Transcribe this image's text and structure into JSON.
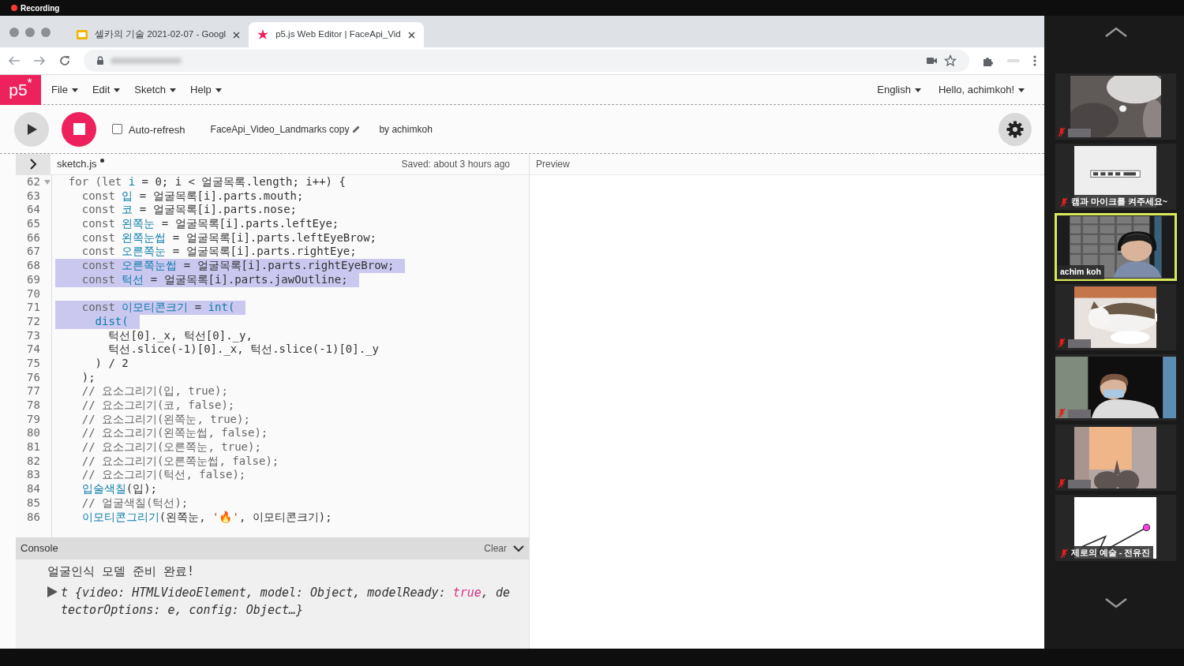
{
  "recording": {
    "label": "Recording"
  },
  "browser": {
    "tabs": [
      {
        "title": "셀카의 기술 2021-02-07 - Googl",
        "kind": "slides",
        "selected": false
      },
      {
        "title": "p5.js Web Editor | FaceApi_Vid",
        "kind": "p5",
        "selected": true
      }
    ]
  },
  "editor": {
    "logo": "p5$^{*}$",
    "menu": [
      "File",
      "Edit",
      "Sketch",
      "Help"
    ],
    "menu_right": [
      "English",
      "Hello, achimkoh!"
    ],
    "toolbar": {
      "playing": true,
      "auto_refresh": {
        "label": "Auto-refresh",
        "checked": false
      },
      "sketch_name": "FaceApi_Video_Landmarks copy",
      "author": "by achimkoh"
    },
    "file": {
      "sidebar_expanded": false,
      "name": "sketch.js",
      "unsaved": true,
      "saved_status": "Saved: about 3 hours ago"
    },
    "preview_label": "Preview",
    "code": [
      {
        "number": "62",
        "fold": true,
        "selected": false,
        "segments": [
          {
            "kind": "kw",
            "text": "  for (let "
          },
          {
            "kind": "def",
            "text": "i"
          },
          {
            "kind": "plain",
            "text": " = 0; i < 얼굴목록.length; i++) {"
          }
        ]
      },
      {
        "number": "63",
        "selected": false,
        "segments": [
          {
            "kind": "kw",
            "text": "    const "
          },
          {
            "kind": "def",
            "text": "입"
          },
          {
            "kind": "plain",
            "text": " = 얼굴목록[i].parts.mouth;"
          }
        ]
      },
      {
        "number": "64",
        "selected": false,
        "segments": [
          {
            "kind": "kw",
            "text": "    const "
          },
          {
            "kind": "def",
            "text": "코"
          },
          {
            "kind": "plain",
            "text": " = 얼굴목록[i].parts.nose;"
          }
        ]
      },
      {
        "number": "65",
        "selected": false,
        "segments": [
          {
            "kind": "kw",
            "text": "    const "
          },
          {
            "kind": "def",
            "text": "왼쪽눈"
          },
          {
            "kind": "plain",
            "text": " = 얼굴목록[i].parts.leftEye;"
          }
        ]
      },
      {
        "number": "66",
        "selected": false,
        "segments": [
          {
            "kind": "kw",
            "text": "    const "
          },
          {
            "kind": "def",
            "text": "왼쪽눈썹"
          },
          {
            "kind": "plain",
            "text": " = 얼굴목록[i].parts.leftEyeBrow;"
          }
        ]
      },
      {
        "number": "67",
        "selected": false,
        "segments": [
          {
            "kind": "kw",
            "text": "    const "
          },
          {
            "kind": "def",
            "text": "오른쪽눈"
          },
          {
            "kind": "plain",
            "text": " = 얼굴목록[i].parts.rightEye;"
          }
        ]
      },
      {
        "number": "68",
        "selected": true,
        "segments": [
          {
            "kind": "kw",
            "text": "    const "
          },
          {
            "kind": "def",
            "text": "오른쪽눈썹"
          },
          {
            "kind": "plain",
            "text": " = 얼굴목록[i].parts.rightEyeBrow;"
          }
        ]
      },
      {
        "number": "69",
        "selected": true,
        "segments": [
          {
            "kind": "kw",
            "text": "    const "
          },
          {
            "kind": "def",
            "text": "턱선"
          },
          {
            "kind": "plain",
            "text": " = 얼굴목록[i].parts.jawOutline;"
          }
        ]
      },
      {
        "number": "70"
      },
      {
        "number": "71",
        "selected": true,
        "segments": [
          {
            "kind": "kw",
            "text": "    const "
          },
          {
            "kind": "def",
            "text": "이모티콘크기"
          },
          {
            "kind": "plain",
            "text": " = "
          },
          {
            "kind": "def",
            "text": "int("
          }
        ]
      },
      {
        "number": "72",
        "selected": true,
        "segments": [
          {
            "kind": "def",
            "text": "      dist("
          }
        ]
      },
      {
        "number": "73",
        "selected": false,
        "segments": [
          {
            "kind": "plain",
            "text": "        턱선[0]._x, 턱선[0]._y,"
          }
        ]
      },
      {
        "number": "74",
        "selected": false,
        "segments": [
          {
            "kind": "plain",
            "text": "        턱선.slice(-1)[0]._x, 턱선.slice(-1)[0]._y"
          }
        ]
      },
      {
        "number": "75",
        "selected": false,
        "segments": [
          {
            "kind": "plain",
            "text": "      ) / 2"
          }
        ]
      },
      {
        "number": "76",
        "selected": false,
        "segments": [
          {
            "kind": "plain",
            "text": "    );"
          }
        ]
      },
      {
        "number": "77",
        "selected": false,
        "segments": [
          {
            "kind": "comment",
            "text": "    // 요소그리기(입, true);"
          }
        ]
      },
      {
        "number": "78",
        "selected": false,
        "segments": [
          {
            "kind": "comment",
            "text": "    // 요소그리기(코, false);"
          }
        ]
      },
      {
        "number": "79",
        "selected": false,
        "segments": [
          {
            "kind": "comment",
            "text": "    // 요소그리기(왼쪽눈, true);"
          }
        ]
      },
      {
        "number": "80",
        "selected": false,
        "segments": [
          {
            "kind": "comment",
            "text": "    // 요소그리기(왼쪽눈썹, false);"
          }
        ]
      },
      {
        "number": "81",
        "selected": false,
        "segments": [
          {
            "kind": "comment",
            "text": "    // 요소그리기(오른쪽눈, true);"
          }
        ]
      },
      {
        "number": "82",
        "selected": false,
        "segments": [
          {
            "kind": "comment",
            "text": "    // 요소그리기(오른쪽눈썹, false);"
          }
        ]
      },
      {
        "number": "83",
        "selected": false,
        "segments": [
          {
            "kind": "comment",
            "text": "    // 요소그리기(턱선, false);"
          }
        ]
      },
      {
        "number": "84",
        "selected": false,
        "segments": [
          {
            "kind": "def",
            "text": "    입술색칠"
          },
          {
            "kind": "plain",
            "text": "(입);"
          }
        ]
      },
      {
        "number": "85",
        "selected": false,
        "segments": [
          {
            "kind": "comment",
            "text": "    // 얼굴색칠(턱선);"
          }
        ]
      },
      {
        "number": "86",
        "selected": false,
        "segments": [
          {
            "kind": "def",
            "text": "    이모티콘그리기"
          },
          {
            "kind": "plain",
            "text": "(왼쪽눈, "
          },
          {
            "kind": "string",
            "text": "'🔥'"
          },
          {
            "kind": "plain",
            "text": ", 이모티콘크기);"
          }
        ]
      }
    ],
    "console": {
      "title": "Console",
      "clear": "Clear",
      "messages": [
        {
          "kind": "text",
          "segments": [
            {
              "kind": "plain",
              "text": "얼굴인식 모델 준비 완료!"
            }
          ]
        },
        {
          "kind": "object",
          "segments": [
            {
              "kind": "plain",
              "text": "t {video: HTMLVideoElement, model: Object, modelReady: "
            },
            {
              "kind": "bool",
              "text": "true"
            },
            {
              "kind": "plain",
              "text": ", detectorOptions: e, config: Object…}"
            }
          ]
        }
      ]
    }
  },
  "participants": [
    {
      "kind": "picture",
      "muted": true,
      "selected": false
    },
    {
      "kind": "picture",
      "muted": true,
      "selected": false,
      "label": "캠과 마이크를 켜주세요~"
    },
    {
      "kind": "picture",
      "muted": false,
      "selected": true,
      "label": "achim koh"
    },
    {
      "kind": "picture",
      "muted": true,
      "selected": false
    },
    {
      "kind": "picture",
      "muted": true,
      "selected": false
    },
    {
      "kind": "picture",
      "muted": true,
      "selected": false
    },
    {
      "kind": "picture",
      "muted": true,
      "selected": false,
      "label": "제로의 예술 - 전유진"
    }
  ]
}
